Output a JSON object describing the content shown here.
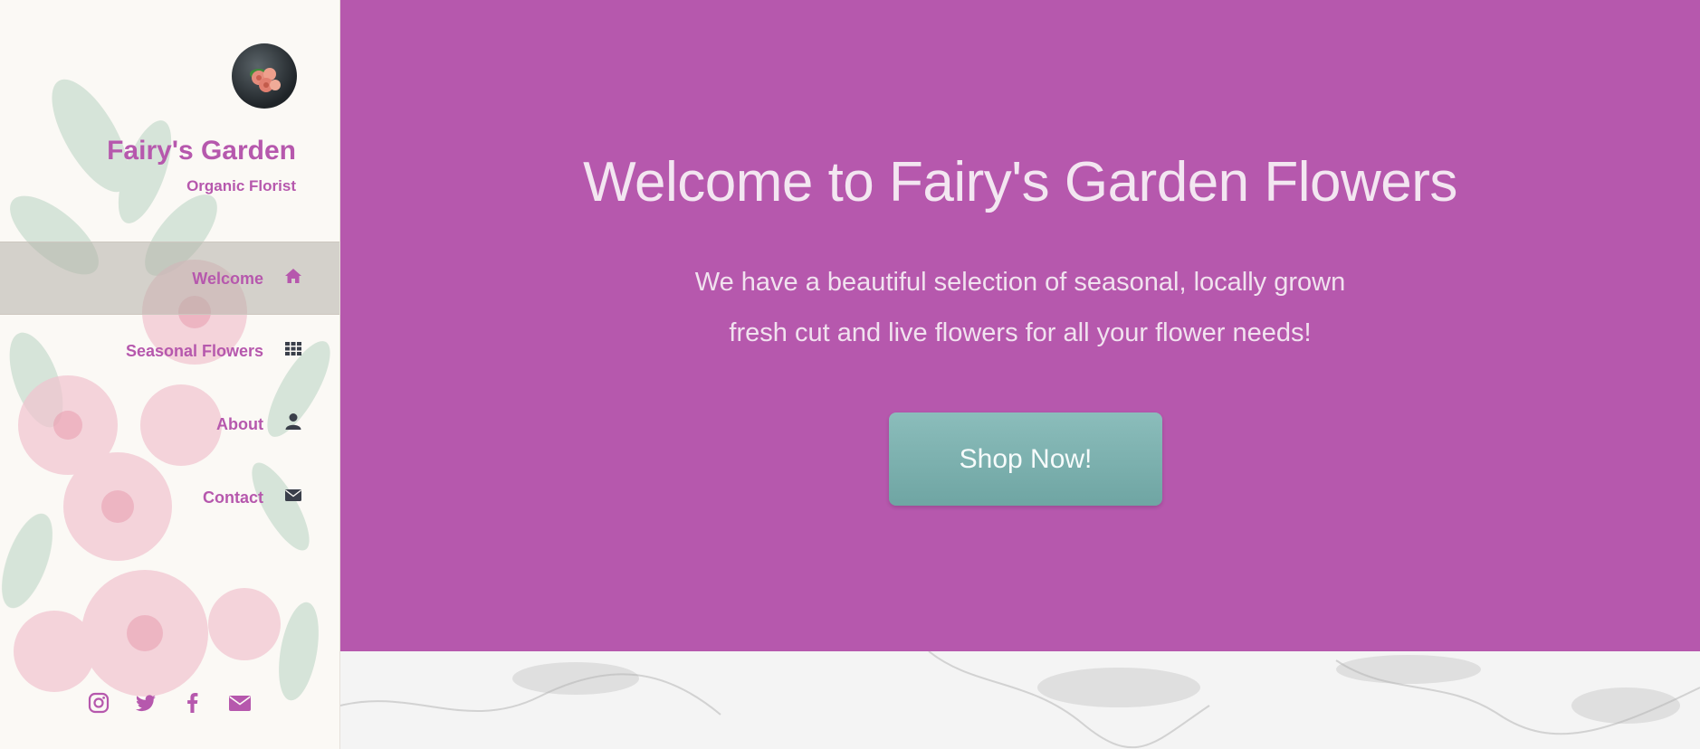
{
  "brand": {
    "title": "Fairy's Garden",
    "subtitle": "Organic Florist"
  },
  "nav": [
    {
      "label": "Welcome",
      "icon": "home-icon",
      "active": true
    },
    {
      "label": "Seasonal Flowers",
      "icon": "grid-icon",
      "active": false
    },
    {
      "label": "About",
      "icon": "user-icon",
      "active": false
    },
    {
      "label": "Contact",
      "icon": "envelope-icon",
      "active": false
    }
  ],
  "socials": [
    "instagram-icon",
    "twitter-icon",
    "facebook-icon",
    "email-icon"
  ],
  "hero": {
    "title": "Welcome to Fairy's Garden Flowers",
    "line1": "We have a beautiful selection of seasonal, locally grown",
    "line2": "fresh cut and live flowers for all your flower needs!",
    "cta": "Shop Now!"
  },
  "colors": {
    "accent": "#b658ad",
    "button": "#7fb3b1",
    "sidebar_bg": "#fbf9f5"
  }
}
